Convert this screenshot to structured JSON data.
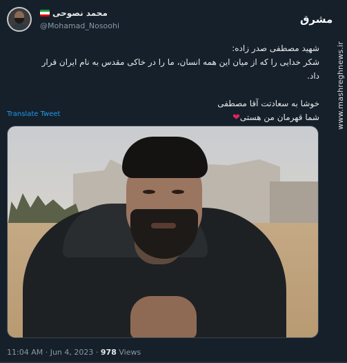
{
  "user": {
    "display_name": "محمد نصوحی",
    "handle": "@Mohamad_Nosoohi",
    "flag_colors": [
      "#239f40",
      "#ffffff",
      "#da0000"
    ]
  },
  "watermark": "مشرق",
  "side_site": "www.mashreghnews.ir",
  "tweet": {
    "line1": "شهید مصطفی صدر زاده:",
    "line2": "شکر خدایی را که از میان این همه انسان، ما را در خاکی مقدس به نام ایران قرار داد.",
    "line3": "خوشا به سعادتت آقا مصطفی",
    "line4": "شما قهرمان من هستی",
    "heart": "❤"
  },
  "translate_label": "Translate Tweet",
  "meta": {
    "time": "11:04 AM",
    "sep1": "·",
    "date": "Jun 4, 2023",
    "sep2": "·",
    "views_count": "978",
    "views_label": "Views"
  }
}
